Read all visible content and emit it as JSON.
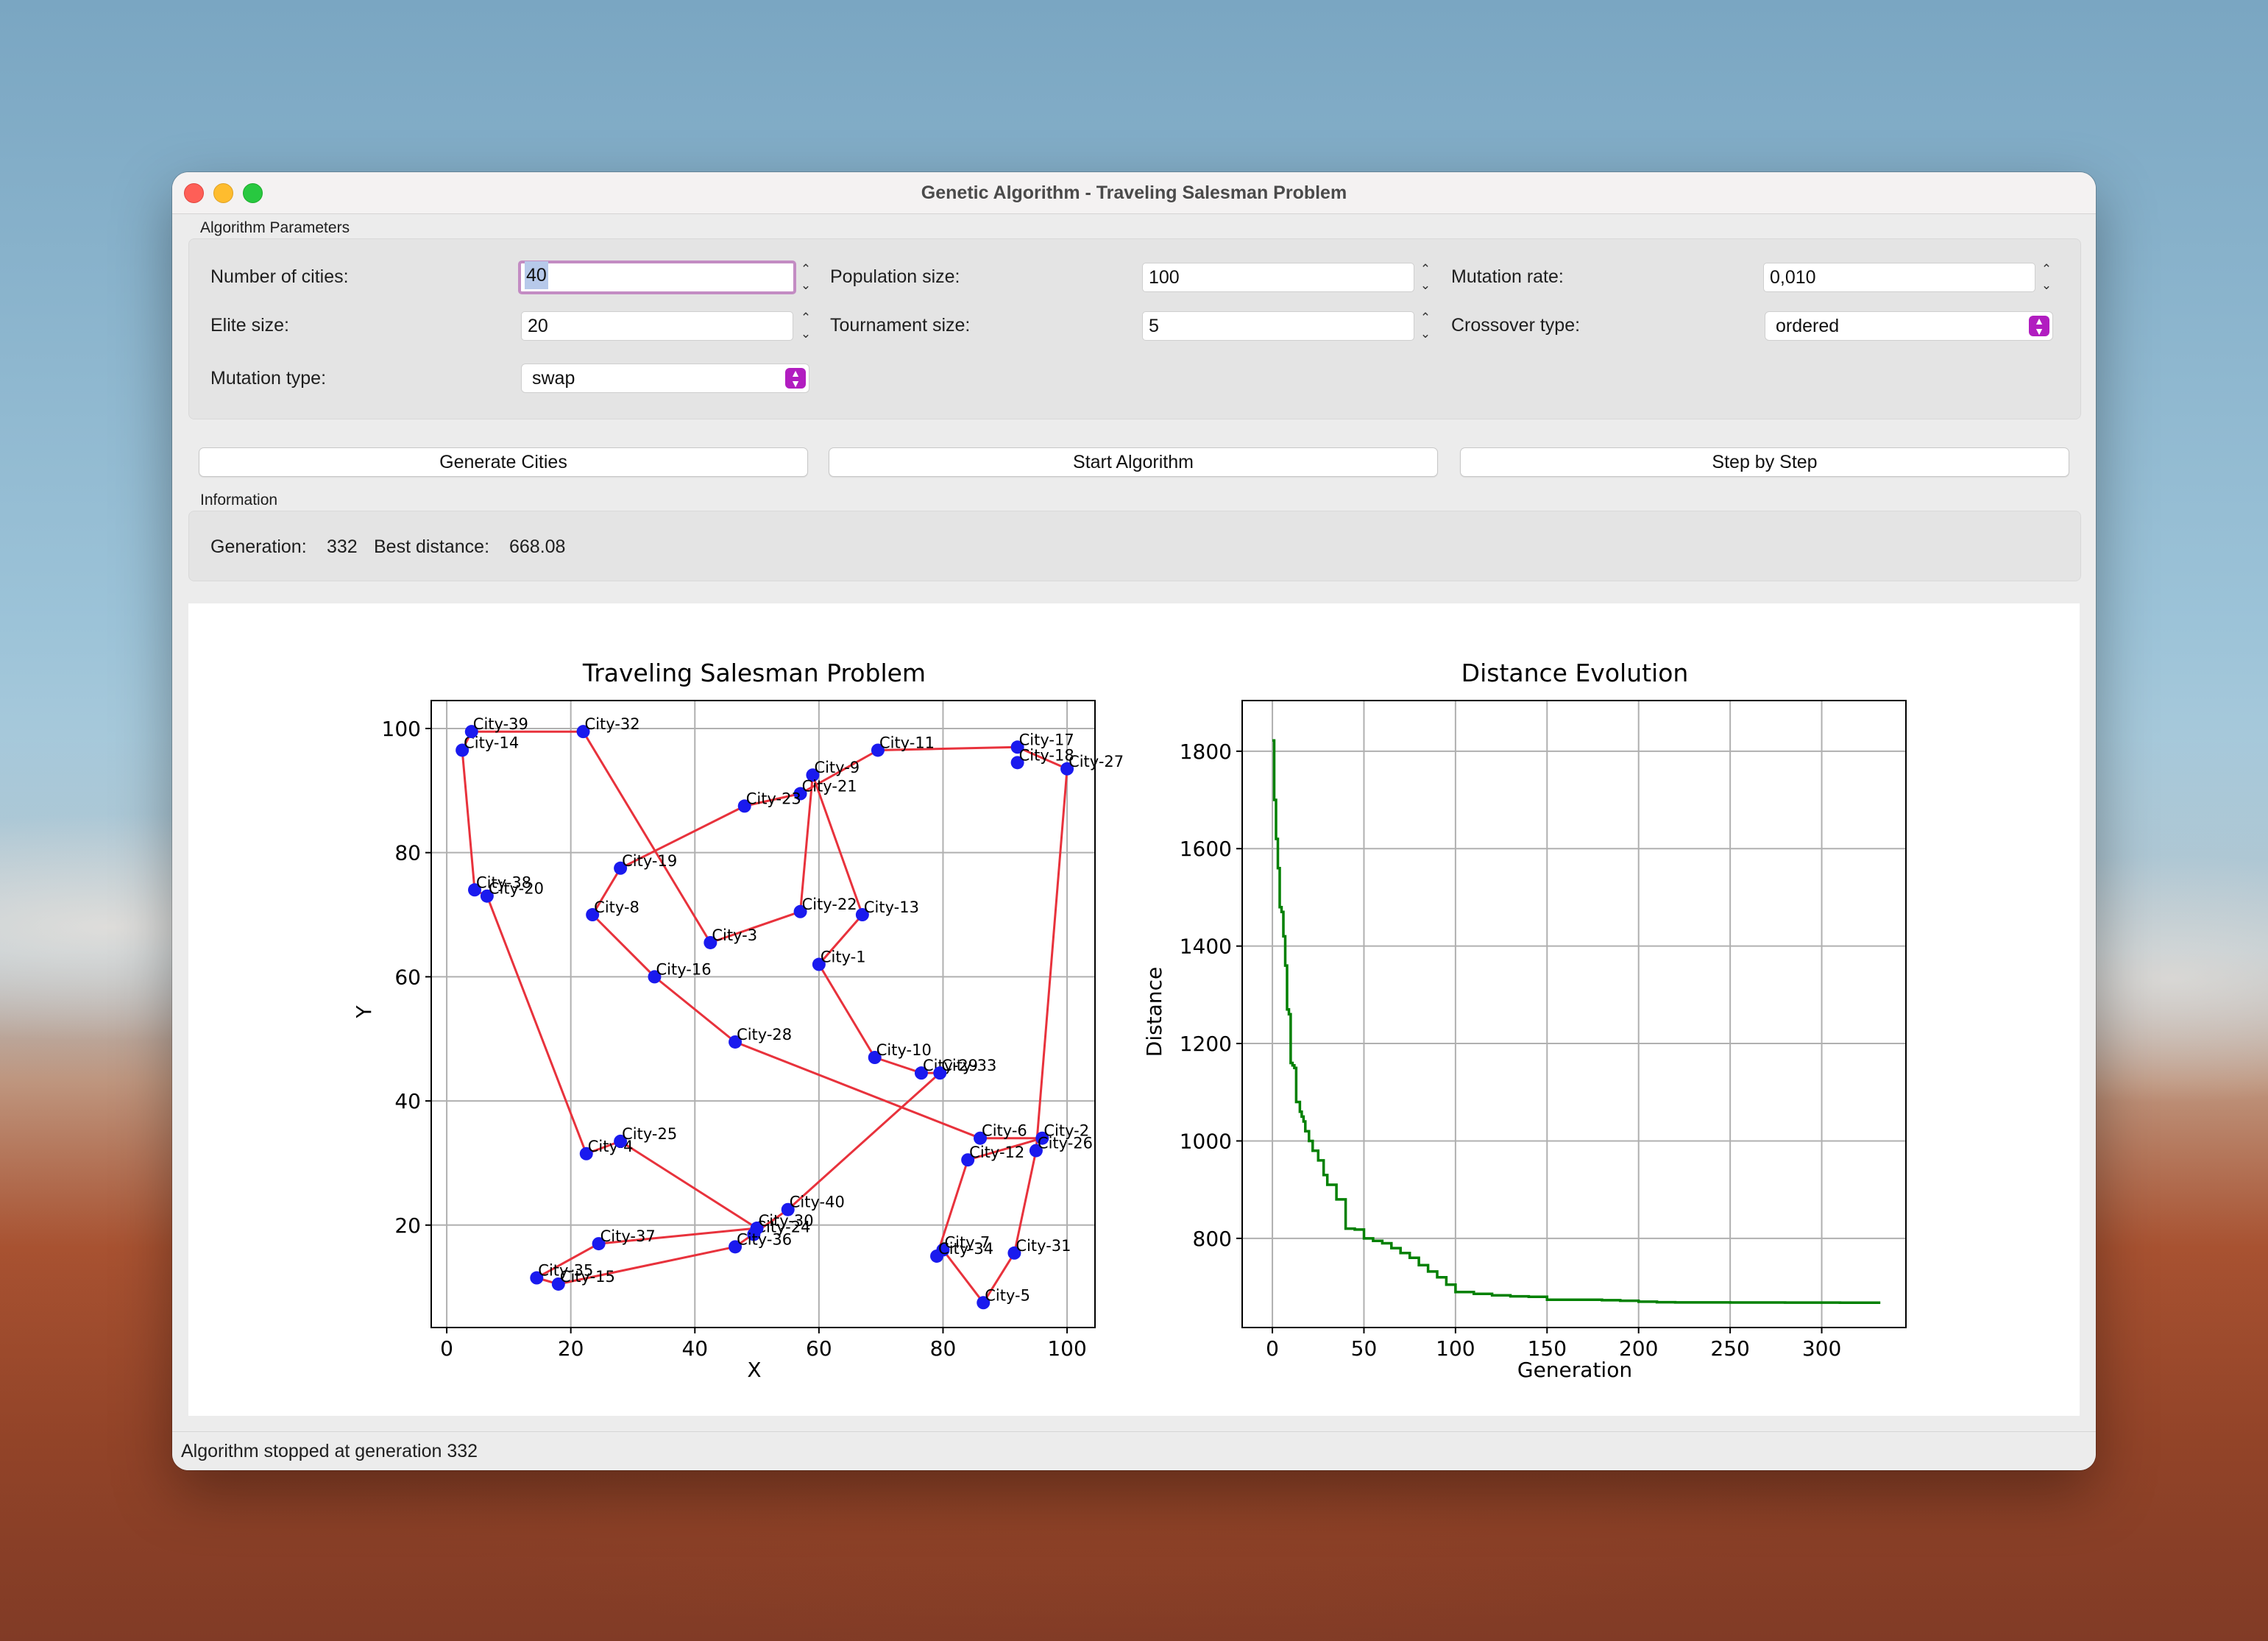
{
  "window": {
    "title": "Genetic Algorithm - Traveling Salesman Problem"
  },
  "params": {
    "section_label": "Algorithm Parameters",
    "num_cities_label": "Number of cities:",
    "num_cities_value": "40",
    "population_label": "Population size:",
    "population_value": "100",
    "mutation_rate_label": "Mutation rate:",
    "mutation_rate_value": "0,010",
    "elite_label": "Elite size:",
    "elite_value": "20",
    "tournament_label": "Tournament size:",
    "tournament_value": "5",
    "crossover_label": "Crossover type:",
    "crossover_value": "ordered",
    "mutation_type_label": "Mutation type:",
    "mutation_type_value": "swap"
  },
  "buttons": {
    "generate": "Generate Cities",
    "start": "Start Algorithm",
    "step": "Step by Step"
  },
  "info": {
    "section_label": "Information",
    "generation_label": "Generation:",
    "generation_value": "332",
    "best_label": "Best distance:",
    "best_value": "668.08"
  },
  "status": {
    "text": "Algorithm stopped at generation 332"
  },
  "colors": {
    "route": "#e8323c",
    "city": "#1a1aee",
    "evolution": "#008000",
    "accent": "#b11dc0"
  },
  "chart_data": [
    {
      "type": "scatter",
      "title": "Traveling Salesman Problem",
      "xlabel": "X",
      "ylabel": "Y",
      "xlim": [
        -2.5,
        104.5
      ],
      "ylim": [
        3.5,
        104.5
      ],
      "xticks": [
        0,
        20,
        40,
        60,
        80,
        100
      ],
      "yticks": [
        20,
        40,
        60,
        80,
        100
      ],
      "grid": true,
      "cities": [
        {
          "name": "City-1",
          "x": 60,
          "y": 62
        },
        {
          "name": "City-2",
          "x": 96,
          "y": 34
        },
        {
          "name": "City-3",
          "x": 42.5,
          "y": 65.5
        },
        {
          "name": "City-4",
          "x": 22.5,
          "y": 31.5
        },
        {
          "name": "City-5",
          "x": 86.5,
          "y": 7.5
        },
        {
          "name": "City-6",
          "x": 86,
          "y": 34
        },
        {
          "name": "City-7",
          "x": 80,
          "y": 16
        },
        {
          "name": "City-8",
          "x": 23.5,
          "y": 70
        },
        {
          "name": "City-9",
          "x": 59,
          "y": 92.5
        },
        {
          "name": "City-10",
          "x": 69,
          "y": 47
        },
        {
          "name": "City-11",
          "x": 69.5,
          "y": 96.5
        },
        {
          "name": "City-12",
          "x": 84,
          "y": 30.5
        },
        {
          "name": "City-13",
          "x": 67,
          "y": 70
        },
        {
          "name": "City-14",
          "x": 2.5,
          "y": 96.5
        },
        {
          "name": "City-15",
          "x": 18,
          "y": 10.5
        },
        {
          "name": "City-16",
          "x": 33.5,
          "y": 60
        },
        {
          "name": "City-17",
          "x": 92,
          "y": 97
        },
        {
          "name": "City-18",
          "x": 92,
          "y": 94.5
        },
        {
          "name": "City-19",
          "x": 28,
          "y": 77.5
        },
        {
          "name": "City-20",
          "x": 6.5,
          "y": 73
        },
        {
          "name": "City-21",
          "x": 57,
          "y": 89.5
        },
        {
          "name": "City-22",
          "x": 57,
          "y": 70.5
        },
        {
          "name": "City-23",
          "x": 48,
          "y": 87.5
        },
        {
          "name": "City-24",
          "x": 49.5,
          "y": 18.5
        },
        {
          "name": "City-25",
          "x": 28,
          "y": 33.5
        },
        {
          "name": "City-26",
          "x": 95,
          "y": 32
        },
        {
          "name": "City-27",
          "x": 100,
          "y": 93.5
        },
        {
          "name": "City-28",
          "x": 46.5,
          "y": 49.5
        },
        {
          "name": "City-29",
          "x": 76.5,
          "y": 44.5
        },
        {
          "name": "City-30",
          "x": 50,
          "y": 19.5
        },
        {
          "name": "City-31",
          "x": 91.5,
          "y": 15.5
        },
        {
          "name": "City-32",
          "x": 22,
          "y": 99.5
        },
        {
          "name": "City-33",
          "x": 79.5,
          "y": 44.5
        },
        {
          "name": "City-34",
          "x": 79,
          "y": 15
        },
        {
          "name": "City-35",
          "x": 14.5,
          "y": 11.5
        },
        {
          "name": "City-36",
          "x": 46.5,
          "y": 16.5
        },
        {
          "name": "City-37",
          "x": 24.5,
          "y": 17
        },
        {
          "name": "City-38",
          "x": 4.5,
          "y": 74
        },
        {
          "name": "City-39",
          "x": 4,
          "y": 99.5
        },
        {
          "name": "City-40",
          "x": 55,
          "y": 22.5
        }
      ],
      "route": [
        "City-39",
        "City-32",
        "City-3",
        "City-22",
        "City-9",
        "City-13",
        "City-1",
        "City-10",
        "City-29",
        "City-33",
        "City-40",
        "City-36",
        "City-15",
        "City-35",
        "City-37",
        "City-30",
        "City-25",
        "City-4",
        "City-20",
        "City-38",
        "City-14",
        "City-39"
      ],
      "route2": [
        "City-23",
        "City-21",
        "City-11",
        "City-17",
        "City-27",
        "City-26",
        "City-31",
        "City-5",
        "City-7",
        "City-34",
        "City-12",
        "City-2",
        "City-6",
        "City-28",
        "City-16",
        "City-8",
        "City-19",
        "City-23"
      ]
    },
    {
      "type": "line",
      "title": "Distance Evolution",
      "xlabel": "Generation",
      "ylabel": "Distance",
      "xlim": [
        -16.5,
        346
      ],
      "ylim": [
        617,
        1904
      ],
      "xticks": [
        0,
        50,
        100,
        150,
        200,
        250,
        300
      ],
      "yticks": [
        800,
        1000,
        1200,
        1400,
        1600,
        1800
      ],
      "grid": true,
      "series": [
        {
          "x": [
            0,
            1,
            2,
            3,
            4,
            5,
            6,
            7,
            8,
            9,
            10,
            11,
            12,
            13,
            15,
            16,
            17,
            18,
            20,
            22,
            25,
            28,
            30,
            35,
            40,
            45,
            50,
            55,
            60,
            65,
            70,
            75,
            80,
            85,
            90,
            95,
            100,
            110,
            120,
            130,
            140,
            150,
            160,
            170,
            180,
            190,
            200,
            210,
            220,
            250,
            280,
            310,
            332
          ],
          "values": [
            1822,
            1700,
            1620,
            1560,
            1480,
            1470,
            1420,
            1360,
            1270,
            1260,
            1160,
            1155,
            1150,
            1080,
            1060,
            1050,
            1040,
            1020,
            1000,
            980,
            960,
            930,
            910,
            880,
            820,
            818,
            800,
            795,
            790,
            780,
            770,
            760,
            745,
            732,
            720,
            705,
            690,
            686,
            683,
            681,
            680,
            674,
            674,
            674,
            673,
            672,
            670,
            669,
            668.5,
            668.3,
            668.2,
            668.1,
            668.08
          ]
        }
      ]
    }
  ]
}
